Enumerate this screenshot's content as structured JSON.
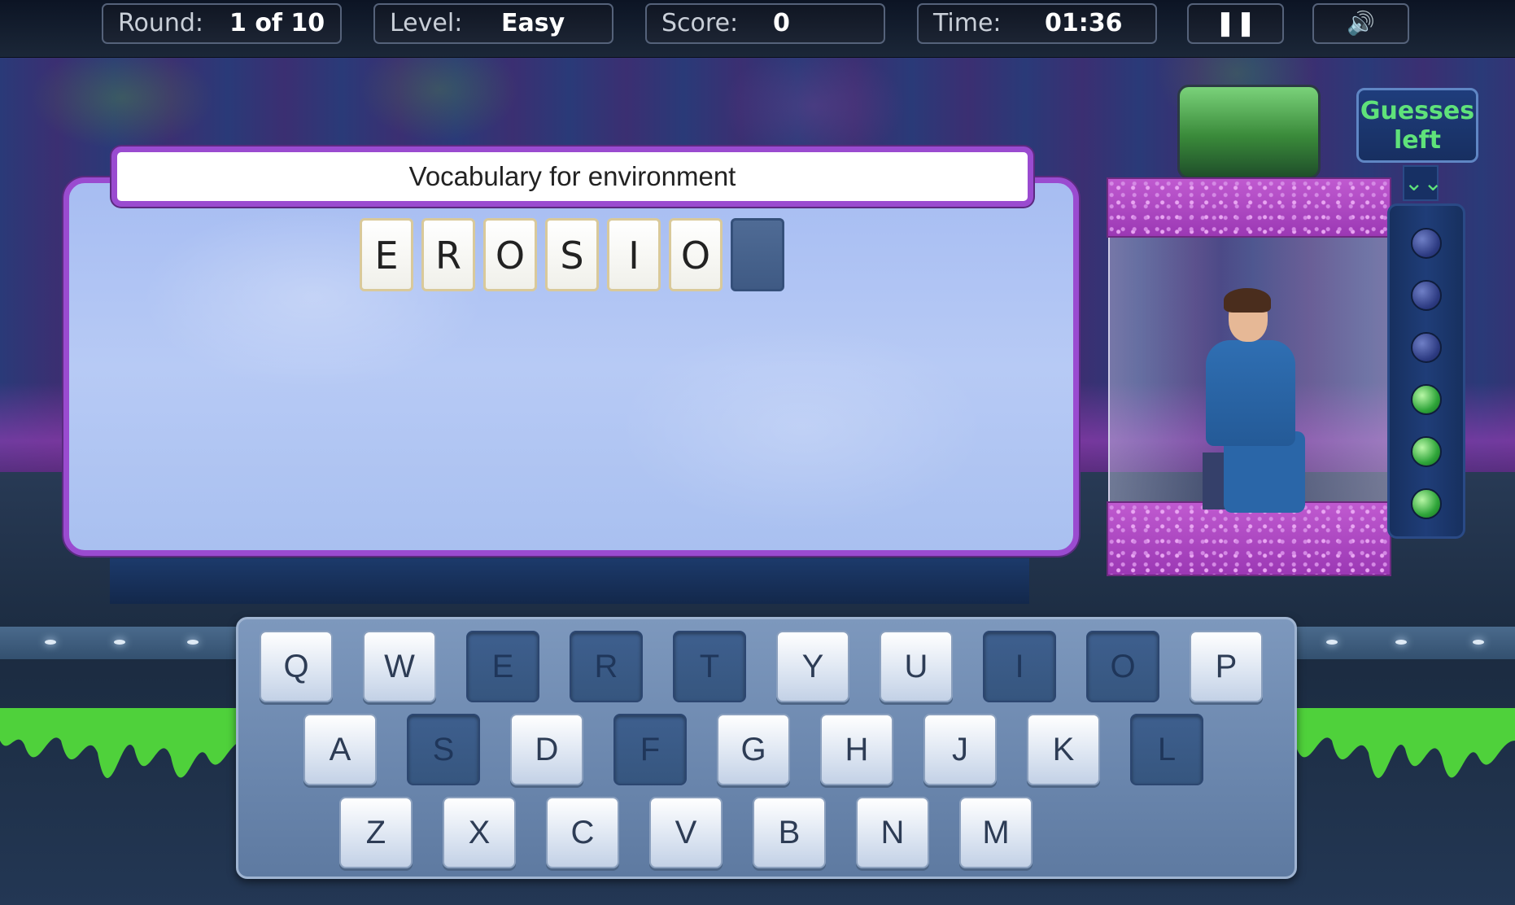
{
  "hud": {
    "round_label": "Round:",
    "round_value": "1 of 10",
    "level_label": "Level:",
    "level_value": "Easy",
    "score_label": "Score:",
    "score_value": "0",
    "time_label": "Time:",
    "time_value": "01:36",
    "pause_symbol": "❚❚",
    "sound_symbol": "🔊"
  },
  "clue": {
    "topic": "Vocabulary for environment",
    "tiles": [
      "E",
      "R",
      "O",
      "S",
      "I",
      "O",
      ""
    ]
  },
  "guesses": {
    "label_line1": "Guesses",
    "label_line2": "left",
    "chevron": "⌄⌄",
    "total": 6,
    "remaining": 3
  },
  "keyboard": {
    "rows": [
      [
        {
          "k": "Q",
          "used": false
        },
        {
          "k": "W",
          "used": false
        },
        {
          "k": "E",
          "used": true
        },
        {
          "k": "R",
          "used": true
        },
        {
          "k": "T",
          "used": true
        },
        {
          "k": "Y",
          "used": false
        },
        {
          "k": "U",
          "used": false
        },
        {
          "k": "I",
          "used": true
        },
        {
          "k": "O",
          "used": true
        },
        {
          "k": "P",
          "used": false
        }
      ],
      [
        {
          "k": "A",
          "used": false
        },
        {
          "k": "S",
          "used": true
        },
        {
          "k": "D",
          "used": false
        },
        {
          "k": "F",
          "used": true
        },
        {
          "k": "G",
          "used": false
        },
        {
          "k": "H",
          "used": false
        },
        {
          "k": "J",
          "used": false
        },
        {
          "k": "K",
          "used": false
        },
        {
          "k": "L",
          "used": true
        }
      ],
      [
        {
          "k": "Z",
          "used": false
        },
        {
          "k": "X",
          "used": false
        },
        {
          "k": "C",
          "used": false
        },
        {
          "k": "V",
          "used": false
        },
        {
          "k": "B",
          "used": false
        },
        {
          "k": "N",
          "used": false
        },
        {
          "k": "M",
          "used": false
        }
      ]
    ]
  },
  "colors": {
    "panel_border": "#9a4bd0",
    "guess_text": "#5fe27a",
    "key_used": "#3e5f8e"
  }
}
